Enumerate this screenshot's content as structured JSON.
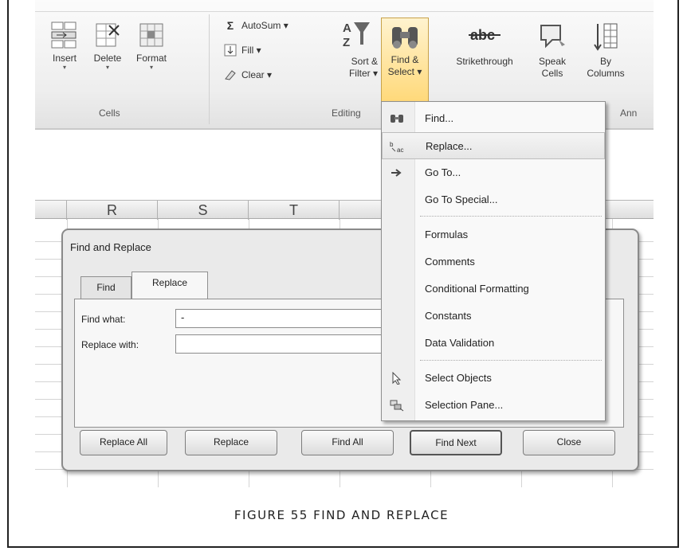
{
  "ribbon": {
    "cells": {
      "label": "Cells",
      "insert_label": "Insert",
      "delete_label": "Delete",
      "format_label": "Format",
      "arrow": "▾"
    },
    "editing": {
      "label": "Editing",
      "autosum_label": "AutoSum ▾",
      "fill_label": "Fill ▾",
      "clear_label": "Clear ▾",
      "sort_filter_line1": "Sort &",
      "sort_filter_line2": "Filter ▾",
      "find_select_line1": "Find &",
      "find_select_line2": "Select ▾"
    },
    "other": {
      "strikethrough_label": "Strikethrough",
      "speak_cells_line1": "Speak",
      "speak_cells_line2": "Cells",
      "by_columns_line1": "By",
      "by_columns_line2": "Columns",
      "ann_label": "Ann"
    }
  },
  "sheet": {
    "columns": [
      "R",
      "S",
      "T"
    ]
  },
  "dialog": {
    "title": "Find and Replace",
    "tabs": [
      "Find",
      "Replace"
    ],
    "find_what_label": "Find what:",
    "find_what_value": "-",
    "replace_with_label": "Replace with:",
    "replace_with_value": "",
    "buttons": {
      "replace_all": "Replace All",
      "replace": "Replace",
      "find_all": "Find All",
      "find_next": "Find Next",
      "close": "Close"
    }
  },
  "menu": {
    "items": [
      {
        "label": "Find...",
        "icon": "binoculars-icon"
      },
      {
        "label": "Replace...",
        "icon": "replace-icon"
      },
      {
        "label": "Go To...",
        "icon": "arrow-right-icon"
      },
      {
        "label": "Go To Special...",
        "icon": ""
      },
      {
        "label": "Formulas",
        "icon": ""
      },
      {
        "label": "Comments",
        "icon": ""
      },
      {
        "label": "Conditional Formatting",
        "icon": ""
      },
      {
        "label": "Constants",
        "icon": ""
      },
      {
        "label": "Data Validation",
        "icon": ""
      },
      {
        "label": "Select Objects",
        "icon": "pointer-icon"
      },
      {
        "label": "Selection Pane...",
        "icon": "selection-pane-icon"
      }
    ]
  },
  "caption": "FIGURE 55 FIND AND REPLACE"
}
